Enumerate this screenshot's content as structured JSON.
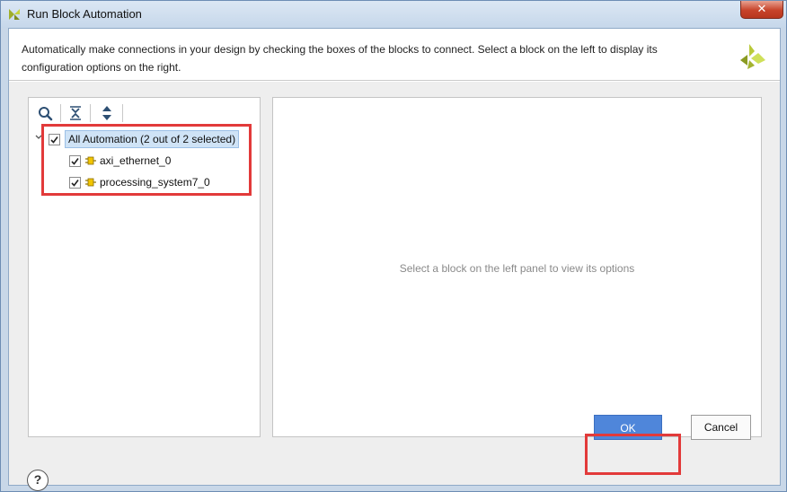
{
  "window": {
    "title": "Run Block Automation",
    "close_symbol": "✕"
  },
  "header": {
    "description": "Automatically make connections in your design by checking the boxes of the blocks to connect. Select a block on the left to display its configuration options on the right."
  },
  "toolbar": {
    "icons": [
      "search-icon",
      "collapse-all-icon",
      "expand-all-icon"
    ]
  },
  "tree": {
    "root": {
      "label": "All Automation (2 out of 2 selected)",
      "checked": true,
      "expanded": true
    },
    "children": [
      {
        "label": "axi_ethernet_0",
        "checked": true,
        "icon": "ip-block-icon"
      },
      {
        "label": "processing_system7_0",
        "checked": true,
        "icon": "ip-block-icon"
      }
    ]
  },
  "options_panel": {
    "placeholder": "Select a block on the left panel to view its options"
  },
  "footer": {
    "help_symbol": "?",
    "ok_label": "OK",
    "cancel_label": "Cancel"
  },
  "colors": {
    "highlight": "#e23a3a",
    "primary_button": "#4f86da",
    "selection": "#cfe3f6"
  }
}
